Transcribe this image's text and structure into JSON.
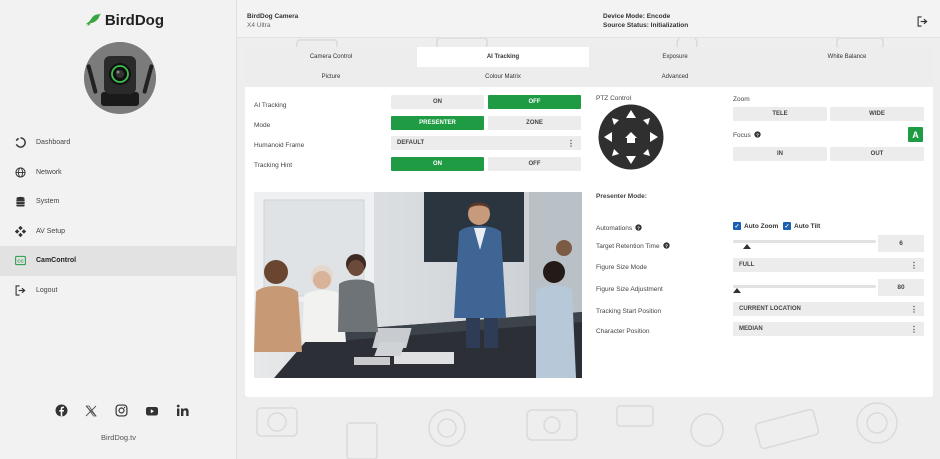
{
  "sidebar": {
    "logo_text": "BirdDog",
    "nav": [
      {
        "label": "Dashboard",
        "icon": "dashboard-icon"
      },
      {
        "label": "Network",
        "icon": "globe-icon"
      },
      {
        "label": "System",
        "icon": "database-icon"
      },
      {
        "label": "AV Setup",
        "icon": "av-setup-icon"
      },
      {
        "label": "CamControl",
        "icon": "camcontrol-icon"
      },
      {
        "label": "Logout",
        "icon": "logout-icon"
      }
    ],
    "active_nav": "CamControl",
    "social_icons": [
      "facebook-icon",
      "x-icon",
      "instagram-icon",
      "youtube-icon",
      "linkedin-icon"
    ],
    "site": "BirdDog.tv"
  },
  "header": {
    "camera_name": "BirdDog Camera",
    "camera_model": "X4 Ultra",
    "device_mode": "Device Mode: Encode",
    "source_status": "Source Status: Initialization"
  },
  "tabs": [
    "Camera Control",
    "AI Tracking",
    "Exposure",
    "White Balance",
    "Picture",
    "Colour Matrix",
    "Advanced"
  ],
  "active_tab": "AI Tracking",
  "left_controls": {
    "ai_tracking": {
      "label": "AI Tracking",
      "on": "ON",
      "off": "OFF",
      "selected": "OFF"
    },
    "mode": {
      "label": "Mode",
      "presenter": "PRESENTER",
      "zone": "ZONE",
      "selected": "PRESENTER"
    },
    "humanoid_frame": {
      "label": "Humanoid Frame",
      "value": "DEFAULT"
    },
    "tracking_hint": {
      "label": "Tracking Hint",
      "on": "ON",
      "off": "OFF",
      "selected": "ON"
    }
  },
  "ptz": {
    "label": "PTZ Control"
  },
  "zoom": {
    "label": "Zoom",
    "tele": "TELE",
    "wide": "WIDE"
  },
  "focus": {
    "label": "Focus",
    "auto": "A",
    "in": "IN",
    "out": "OUT"
  },
  "presenter": {
    "title": "Presenter Mode:",
    "automations_label": "Automations",
    "auto_zoom": "Auto Zoom",
    "auto_tilt": "Auto Tilt",
    "retention_label": "Target Retention Time",
    "retention_value": "6",
    "retention_fraction": 0.1,
    "figure_size_mode_label": "Figure Size Mode",
    "figure_size_mode_value": "FULL",
    "figure_size_adj_label": "Figure Size Adjustment",
    "figure_size_adj_value": "80",
    "figure_size_adj_fraction": 0.0,
    "tracking_start_label": "Tracking Start Position",
    "tracking_start_value": "CURRENT LOCATION",
    "character_pos_label": "Character Position",
    "character_pos_value": "MEDIAN"
  },
  "colors": {
    "accent_green": "#1f9b44",
    "checkbox_blue": "#1a5fb4"
  }
}
